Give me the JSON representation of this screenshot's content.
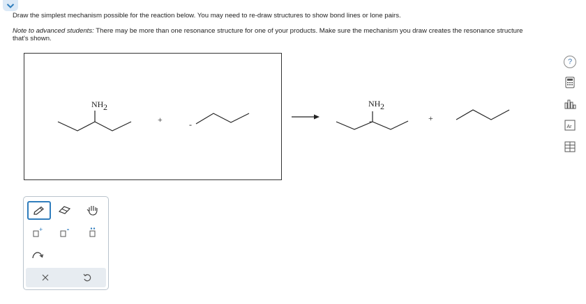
{
  "header": {
    "collapse_icon": "chevron-down-icon"
  },
  "question": {
    "instruction": "Draw the simplest mechanism possible for the reaction below. You may need to re-draw structures to show bond lines or lone pairs.",
    "note_prefix": "Note to advanced students:",
    "note_text": " There may be more than one resonance structure for one of your products. Make sure the mechanism you draw creates the resonance structure that's shown."
  },
  "reaction": {
    "reactant_group_label": "NH",
    "reactant_group_subscript": "2",
    "plus_1": "+",
    "product_group_label": "NH",
    "product_group_subscript": "2",
    "plus_2": "+",
    "reactant_charge": "-",
    "product_charge": "-"
  },
  "toolbox": {
    "tools": [
      {
        "name": "pencil-icon",
        "selected": true
      },
      {
        "name": "eraser-icon"
      },
      {
        "name": "hand-icon"
      },
      {
        "name": "add-positive-charge-icon"
      },
      {
        "name": "add-negative-charge-icon"
      },
      {
        "name": "add-lone-pair-icon"
      },
      {
        "name": "curved-arrow-icon"
      },
      {
        "name": "clear-icon"
      },
      {
        "name": "undo-icon"
      }
    ]
  },
  "sidebar": {
    "help_label": "?",
    "icons": [
      "help-icon",
      "calculator-icon",
      "bar-chart-icon",
      "periodic-table-icon",
      "data-table-icon"
    ]
  }
}
